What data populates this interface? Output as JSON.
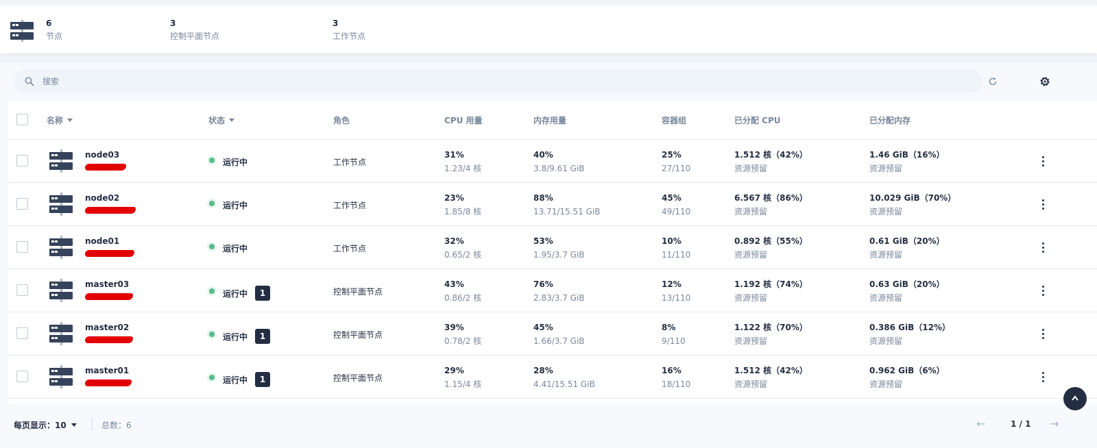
{
  "summary": {
    "stats": [
      {
        "value": "6",
        "label": "节点"
      },
      {
        "value": "3",
        "label": "控制平面节点"
      },
      {
        "value": "3",
        "label": "工作节点"
      }
    ]
  },
  "search": {
    "placeholder": "搜索"
  },
  "table": {
    "headers": {
      "name": "名称",
      "status": "状态",
      "role": "角色",
      "cpu": "CPU 用量",
      "memory": "内存用量",
      "pods": "容器组",
      "alloc_cpu": "已分配 CPU",
      "alloc_mem": "已分配内存"
    },
    "rows": [
      {
        "name": "node03",
        "status": "运行中",
        "badge": "",
        "role": "工作节点",
        "cpu_pct": "31%",
        "cpu_detail": "1.23/4 核",
        "mem_pct": "40%",
        "mem_detail": "3.8/9.61 GiB",
        "pods_pct": "25%",
        "pods_detail": "27/110",
        "alloc_cpu": "1.512 核（42%）",
        "alloc_cpu_sub": "资源预留",
        "alloc_mem": "1.46 GiB（16%）",
        "alloc_mem_sub": "资源预留"
      },
      {
        "name": "node02",
        "status": "运行中",
        "badge": "",
        "role": "工作节点",
        "cpu_pct": "23%",
        "cpu_detail": "1.85/8 核",
        "mem_pct": "88%",
        "mem_detail": "13.71/15.51 GiB",
        "pods_pct": "45%",
        "pods_detail": "49/110",
        "alloc_cpu": "6.567 核（86%）",
        "alloc_cpu_sub": "资源预留",
        "alloc_mem": "10.029 GiB（70%）",
        "alloc_mem_sub": "资源预留"
      },
      {
        "name": "node01",
        "status": "运行中",
        "badge": "",
        "role": "工作节点",
        "cpu_pct": "32%",
        "cpu_detail": "0.65/2 核",
        "mem_pct": "53%",
        "mem_detail": "1.95/3.7 GiB",
        "pods_pct": "10%",
        "pods_detail": "11/110",
        "alloc_cpu": "0.892 核（55%）",
        "alloc_cpu_sub": "资源预留",
        "alloc_mem": "0.61 GiB（20%）",
        "alloc_mem_sub": "资源预留"
      },
      {
        "name": "master03",
        "status": "运行中",
        "badge": "1",
        "role": "控制平面节点",
        "cpu_pct": "43%",
        "cpu_detail": "0.86/2 核",
        "mem_pct": "76%",
        "mem_detail": "2.83/3.7 GiB",
        "pods_pct": "12%",
        "pods_detail": "13/110",
        "alloc_cpu": "1.192 核（74%）",
        "alloc_cpu_sub": "资源预留",
        "alloc_mem": "0.63 GiB（20%）",
        "alloc_mem_sub": "资源预留"
      },
      {
        "name": "master02",
        "status": "运行中",
        "badge": "1",
        "role": "控制平面节点",
        "cpu_pct": "39%",
        "cpu_detail": "0.78/2 核",
        "mem_pct": "45%",
        "mem_detail": "1.66/3.7 GiB",
        "pods_pct": "8%",
        "pods_detail": "9/110",
        "alloc_cpu": "1.122 核（70%）",
        "alloc_cpu_sub": "资源预留",
        "alloc_mem": "0.386 GiB（12%）",
        "alloc_mem_sub": "资源预留"
      },
      {
        "name": "master01",
        "status": "运行中",
        "badge": "1",
        "role": "控制平面节点",
        "cpu_pct": "29%",
        "cpu_detail": "1.15/4 核",
        "mem_pct": "28%",
        "mem_detail": "4.41/15.51 GiB",
        "pods_pct": "16%",
        "pods_detail": "18/110",
        "alloc_cpu": "1.512 核（42%）",
        "alloc_cpu_sub": "资源预留",
        "alloc_mem": "0.962 GiB（6%）",
        "alloc_mem_sub": "资源预留"
      }
    ]
  },
  "footer": {
    "per_page": "每页显示：10",
    "total": "总数：6",
    "page": "1 / 1",
    "prev": "←",
    "next": "→"
  },
  "colors": {
    "status_running": "#55bc8a",
    "dark": "#242e42",
    "muted": "#79879c",
    "redaction": "#e30000"
  },
  "icons": [
    "server-icon",
    "search-icon",
    "refresh-icon",
    "gear-icon",
    "more-icon",
    "scroll-top-icon"
  ]
}
